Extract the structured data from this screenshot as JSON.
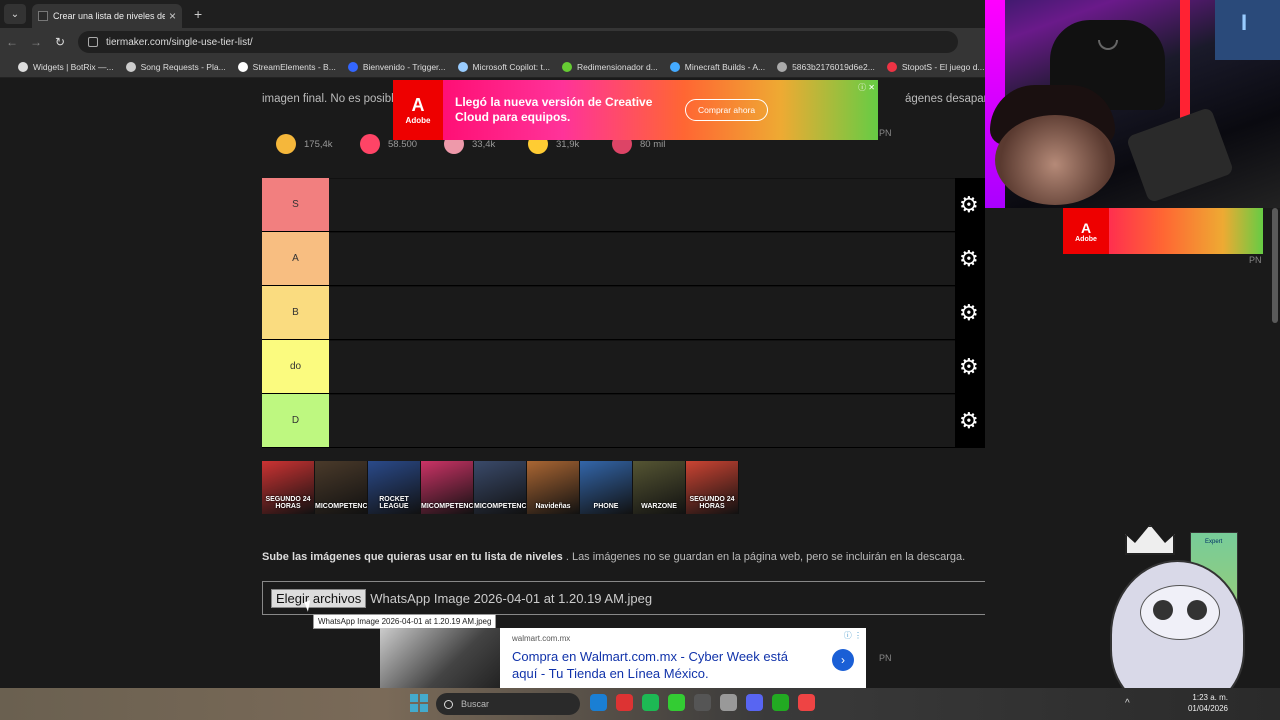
{
  "browser": {
    "tab_title": "Crear una lista de niveles de un",
    "url": "tiermaker.com/single-use-tier-list/",
    "bookmarks": [
      {
        "label": "Widgets | BotRix —...",
        "color": "#ddd"
      },
      {
        "label": "Song Requests - Pla...",
        "color": "#ccc"
      },
      {
        "label": "StreamElements - B...",
        "color": "#fff"
      },
      {
        "label": "Bienvenido - Trigger...",
        "color": "#36f"
      },
      {
        "label": "Microsoft Copilot: t...",
        "color": "#9cf"
      },
      {
        "label": "Redimensionador d...",
        "color": "#6c3"
      },
      {
        "label": "Minecraft Builds - A...",
        "color": "#4af"
      },
      {
        "label": "5863b2176019d6e2...",
        "color": "#aaa"
      },
      {
        "label": "StopotS - El juego d...",
        "color": "#e34"
      }
    ]
  },
  "intro": {
    "line1_left": "",
    "line2": "imagen final. No es posible",
    "line2_right": "ágenes desaparecer"
  },
  "reactions": [
    {
      "count": "175,4k",
      "color": "#f5b73b"
    },
    {
      "count": "58.500",
      "color": "#f46"
    },
    {
      "count": "33,4k",
      "color": "#e9a"
    },
    {
      "count": "31,9k",
      "color": "#fc3"
    },
    {
      "count": "80 mil",
      "color": "#d46"
    }
  ],
  "ad_top": {
    "brand": "Adobe",
    "headline": "Llegó la nueva versión de Creative Cloud para equipos.",
    "cta": "Comprar ahora"
  },
  "pn_label": "PN",
  "tiers": [
    {
      "label": "S",
      "color": "#f27f7f"
    },
    {
      "label": "A",
      "color": "#f8be81"
    },
    {
      "label": "B",
      "color": "#fadc80"
    },
    {
      "label": "do",
      "color": "#fbfb7f"
    },
    {
      "label": "D",
      "color": "#bef880"
    }
  ],
  "thumbnails": [
    {
      "caption": "SEGUNDO 24 HORAS",
      "bg": "#c33"
    },
    {
      "caption": "MICOMPETENCIAS",
      "bg": "#4a3a2a"
    },
    {
      "caption": "ROCKET LEAGUE",
      "bg": "#2a4a8a"
    },
    {
      "caption": "MICOMPETENCIAS",
      "bg": "#c36"
    },
    {
      "caption": "MICOMPETENCIAS",
      "bg": "#3a4a6a"
    },
    {
      "caption": "Navideñas",
      "bg": "#a63"
    },
    {
      "caption": "PHONE",
      "bg": "#36a"
    },
    {
      "caption": "WARZONE",
      "bg": "#553"
    },
    {
      "caption": "SEGUNDO 24 HORAS",
      "bg": "#c43"
    }
  ],
  "upload": {
    "bold": "Sube las imágenes que quieras usar en tu lista de niveles",
    "rest": " . Las imágenes no se guardan en la página web, pero se incluirán en la descarga.",
    "button": "Elegir archivos",
    "filename": "WhatsApp Image 2026-04-01 at 1.20.19 AM.jpeg",
    "tooltip": "WhatsApp Image 2026-04-01 at 1.20.19 AM.jpeg"
  },
  "ad_bottom": {
    "domain": "walmart.com.mx",
    "headline": "Compra en Walmart.com.mx - Cyber Week está aquí - Tu Tienda en Línea México."
  },
  "ad_right": {
    "brand": "Adobe"
  },
  "mascot": {
    "card_text": "Expert"
  },
  "taskbar": {
    "search_placeholder": "Buscar",
    "time": "1:23 a. m.",
    "date": "01/04/2026",
    "icons": [
      "#1a7fd4",
      "#d33",
      "#1db954",
      "#3c3",
      "#555",
      "#999",
      "#5865f2",
      "#2a2",
      "#e44"
    ]
  }
}
